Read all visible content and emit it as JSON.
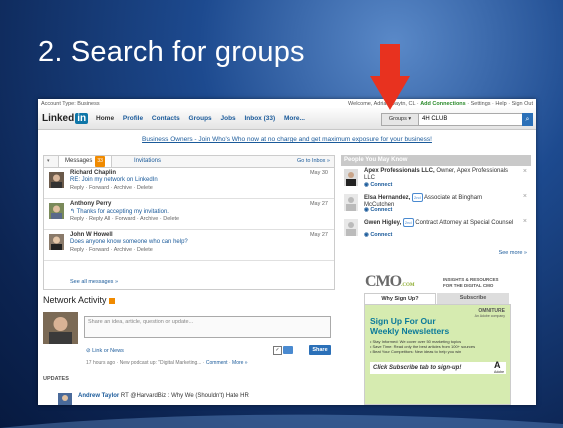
{
  "slide": {
    "title": "2.  Search for groups"
  },
  "topbar": {
    "account_type": "Account Type: Business",
    "welcome": "Welcome, Adrian Dayt",
    "welcome_tail": "n, CL",
    "add_connections": "Add Connections",
    "settings": "Settings",
    "help": "Help",
    "sign_out": "Sign Out"
  },
  "navbar": {
    "logo_text": "Linked",
    "logo_in": "in",
    "items": [
      "Home",
      "Profile",
      "Contacts",
      "Groups",
      "Jobs",
      "Inbox (33)",
      "More..."
    ],
    "search_scope": "Groups ▾",
    "search_value": "4H CLUB"
  },
  "promo": "Business Owners - Join Who's Who now at no charge and get maximum exposure for your business!",
  "messages": {
    "tab_label": "Messages",
    "tab_count": "33",
    "invitations": "Invitations",
    "goto": "Go to Inbox »",
    "items": [
      {
        "from": "Richard Chaplin",
        "subject": "RE: Join my network on LinkedIn",
        "actions": "Reply · Forward · Archive · Delete",
        "date": "May 30"
      },
      {
        "from": "Anthony Perry",
        "subject": "↰ Thanks for accepting my invitation.",
        "actions": "Reply · Reply All · Forward · Archive · Delete",
        "date": "May 27"
      },
      {
        "from": "John W Howell",
        "subject": "Does anyone know someone who can help?",
        "actions": "Reply · Forward · Archive · Delete",
        "date": "May 27"
      }
    ],
    "see_all": "See all messages »"
  },
  "pymk": {
    "header": "People You May Know",
    "people": [
      {
        "name": "Apex Professionals LLC,",
        "desc": " Owner, Apex Professionals LLC",
        "connect": "Connect"
      },
      {
        "name": "Elsa Hernandez,",
        "degree": "2nd",
        "desc": " Associate at Bingham McCutchen",
        "connect": "Connect"
      },
      {
        "name": "Gwen Higley,",
        "degree": "2nd",
        "desc": " Contract Attorney at Special Counsel",
        "connect": "Connect"
      }
    ],
    "see_more": "See more »"
  },
  "network": {
    "title": "Network Activity",
    "share_placeholder": "Share an idea, article, question or update...",
    "link_or_news": "Link or News",
    "share_button": "Share",
    "meta_prefix": "17 hours ago · New podcast up: \"Digital Marketing... · ",
    "meta_comment": "Comment",
    "meta_more": "More »",
    "updates": "UPDATES",
    "update_name": "Andrew Taylor",
    "update_text": " RT @HarvardBiz : Why We (Shouldn't) Hate HR"
  },
  "cmo_ad": {
    "logo": "CMO",
    "logo_suffix": ".COM",
    "insights": "INSIGHTS & RESOURCES",
    "insights2": "FOR THE DIGITAL CMO",
    "tab_why": "Why Sign Up?",
    "tab_subscribe": "Subscribe",
    "omniture": "OMNITURE",
    "omniture_sub": "An Adobe company",
    "headline1": "Sign Up For Our",
    "headline2": "Weekly Newsletters",
    "bullets": [
      "• Stay Informed: We cover over 50 marketing topics",
      "• Save Time: Read only the best articles from 100+ sources",
      "• Beat Your Competitors: New ideas to help you win"
    ],
    "cta": "Click Subscribe tab to sign-up!",
    "adobe": "Adobe"
  },
  "colors": {
    "arrow": "#e8321f",
    "linkedin_blue": "#0e76a8",
    "link": "#1a5a9a"
  }
}
